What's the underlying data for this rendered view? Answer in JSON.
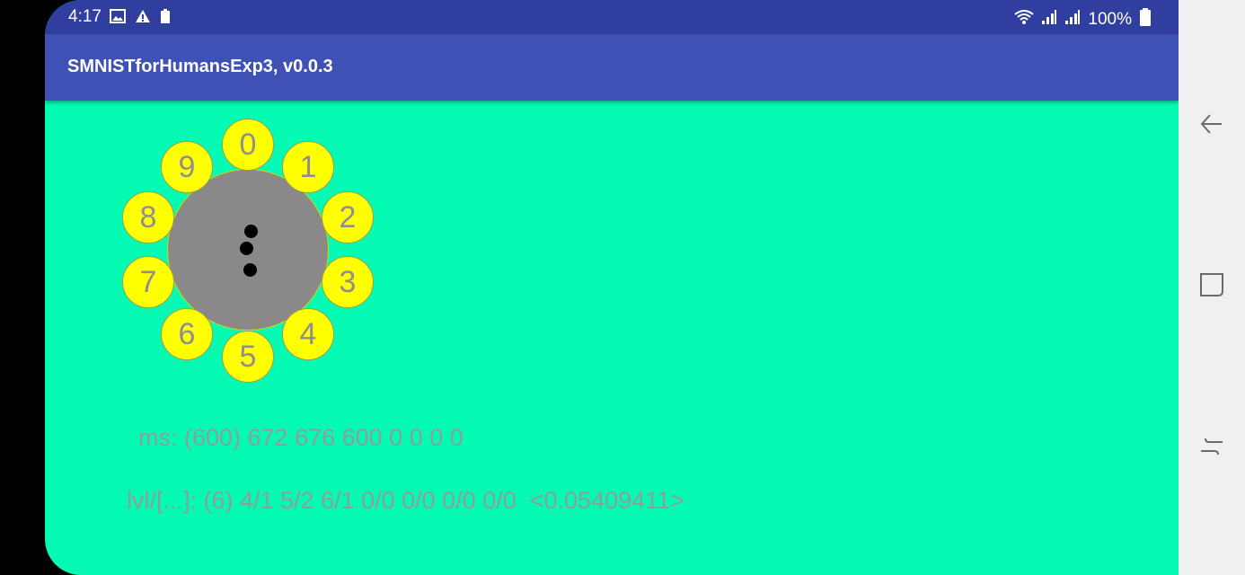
{
  "status_bar": {
    "time": "4:17",
    "left_icons": [
      "image-icon",
      "warning-icon",
      "battery-saver-icon"
    ],
    "battery_text": "100%",
    "right_icons": [
      "wifi-icon",
      "signal-icon",
      "signal-icon",
      "battery-icon"
    ]
  },
  "app_bar": {
    "title": "SMNISTforHumansExp3, v0.0.3"
  },
  "wheel": {
    "digits": [
      "0",
      "1",
      "2",
      "3",
      "4",
      "5",
      "6",
      "7",
      "8",
      "9"
    ]
  },
  "info": {
    "ms_line": "ms: (600) 672 676 600 0 0 0 0",
    "lvl_line": "lvl/[...]: (6) 4/1 5/2 6/1 0/0 0/0 0/0 0/0  <0.05409411>"
  },
  "nav_bar": {
    "buttons": [
      "back-icon",
      "recents-icon",
      "menu-icon"
    ]
  },
  "colors": {
    "status_bar": "#303F9F",
    "app_bar": "#3F51B5",
    "background": "#05FBB4",
    "digit_fill": "#FFFF00",
    "center_disc": "#8A8889"
  }
}
